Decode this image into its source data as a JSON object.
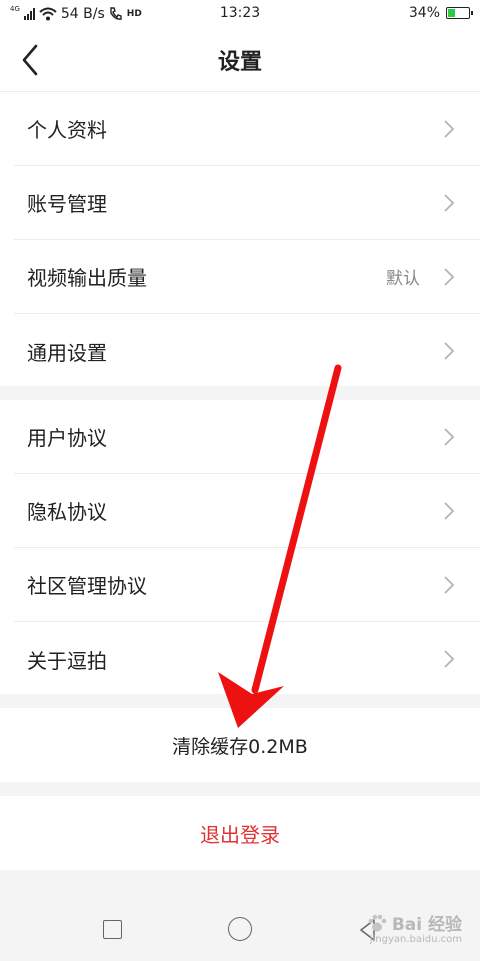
{
  "status_bar": {
    "network_type": "4G",
    "speed": "54 B/s",
    "hd_badge": "HD",
    "time": "13:23",
    "battery_percent": "34%",
    "battery_level": 0.34
  },
  "nav": {
    "title": "设置",
    "back_icon": "chevron-left-icon"
  },
  "groups": [
    {
      "items": [
        {
          "label": "个人资料",
          "value": ""
        },
        {
          "label": "账号管理",
          "value": ""
        },
        {
          "label": "视频输出质量",
          "value": "默认"
        },
        {
          "label": "通用设置",
          "value": ""
        }
      ]
    },
    {
      "items": [
        {
          "label": "用户协议",
          "value": ""
        },
        {
          "label": "隐私协议",
          "value": ""
        },
        {
          "label": "社区管理协议",
          "value": ""
        },
        {
          "label": "关于逗拍",
          "value": ""
        }
      ]
    }
  ],
  "clear_cache": {
    "label": "清除缓存0.2MB"
  },
  "logout": {
    "label": "退出登录",
    "color": "#e03434"
  },
  "watermark": {
    "text": "Bai 经验",
    "sub": "jingyan.baidu.com"
  },
  "annotation_arrow": {
    "color": "#ee1111"
  }
}
